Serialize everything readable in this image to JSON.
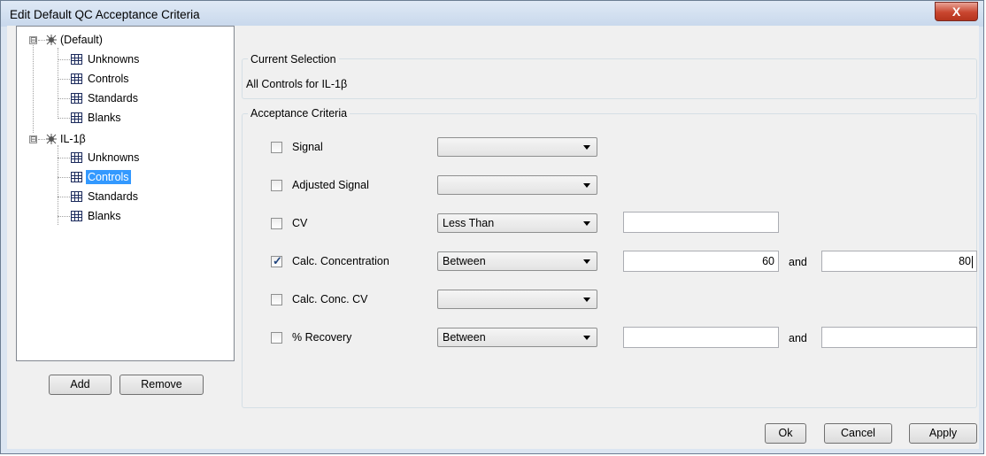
{
  "window": {
    "title": "Edit Default QC Acceptance Criteria",
    "close_label": "X"
  },
  "tree": {
    "nodes": [
      {
        "label": "(Default)",
        "children": [
          "Unknowns",
          "Controls",
          "Standards",
          "Blanks"
        ]
      },
      {
        "label": "IL-1β",
        "children": [
          "Unknowns",
          "Controls",
          "Standards",
          "Blanks"
        ]
      }
    ],
    "selected": "IL-1β / Controls",
    "expander_symbol": "⊟"
  },
  "buttons": {
    "add": "Add",
    "remove": "Remove",
    "ok": "Ok",
    "cancel": "Cancel",
    "apply": "Apply"
  },
  "current_selection": {
    "title": "Current Selection",
    "text": "All Controls for IL-1β"
  },
  "acceptance": {
    "title": "Acceptance Criteria",
    "rows": [
      {
        "label": "Signal",
        "checked": false,
        "operator": "",
        "value1": "",
        "value2": ""
      },
      {
        "label": "Adjusted Signal",
        "checked": false,
        "operator": "",
        "value1": "",
        "value2": ""
      },
      {
        "label": "CV",
        "checked": false,
        "operator": "Less Than",
        "value1": "",
        "value2": ""
      },
      {
        "label": "Calc. Concentration",
        "checked": true,
        "operator": "Between",
        "value1": "60",
        "and_label": "and",
        "value2": "80"
      },
      {
        "label": "Calc. Conc. CV",
        "checked": false,
        "operator": "",
        "value1": "",
        "value2": ""
      },
      {
        "label": "% Recovery",
        "checked": false,
        "operator": "Between",
        "value1": "",
        "and_label": "and",
        "value2": ""
      }
    ]
  },
  "colors": {
    "selection": "#3399ff",
    "titlebar": "#c8d8ec",
    "close_button": "#c9462f"
  }
}
